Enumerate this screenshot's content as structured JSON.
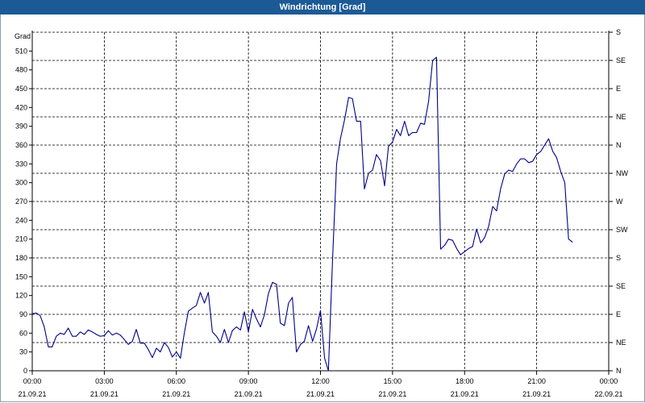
{
  "window": {
    "title": "Windrichtung [Grad]"
  },
  "chart_data": {
    "type": "line",
    "title": "Windrichtung [Grad]",
    "ylabel": "Grad",
    "ylim": [
      0,
      540
    ],
    "yticks": [
      0,
      30,
      60,
      90,
      120,
      150,
      180,
      210,
      240,
      270,
      300,
      330,
      360,
      390,
      420,
      450,
      480,
      510
    ],
    "y2ticks": [
      {
        "value": 0,
        "label": "N"
      },
      {
        "value": 45,
        "label": "NE"
      },
      {
        "value": 90,
        "label": "E"
      },
      {
        "value": 135,
        "label": "SE"
      },
      {
        "value": 180,
        "label": "S"
      },
      {
        "value": 225,
        "label": "SW"
      },
      {
        "value": 270,
        "label": "W"
      },
      {
        "value": 315,
        "label": "NW"
      },
      {
        "value": 360,
        "label": "N"
      },
      {
        "value": 405,
        "label": "NE"
      },
      {
        "value": 450,
        "label": "E"
      },
      {
        "value": 495,
        "label": "SE"
      },
      {
        "value": 540,
        "label": "S"
      }
    ],
    "xlim": [
      0,
      24
    ],
    "xticks": [
      {
        "value": 0,
        "time": "00:00",
        "date": "21.09.21"
      },
      {
        "value": 3,
        "time": "03:00",
        "date": "21.09.21"
      },
      {
        "value": 6,
        "time": "06:00",
        "date": "21.09.21"
      },
      {
        "value": 9,
        "time": "09:00",
        "date": "21.09.21"
      },
      {
        "value": 12,
        "time": "12:00",
        "date": "21.09.21"
      },
      {
        "value": 15,
        "time": "15:00",
        "date": "21.09.21"
      },
      {
        "value": 18,
        "time": "18:00",
        "date": "21.09.21"
      },
      {
        "value": 21,
        "time": "21:00",
        "date": "21.09.21"
      },
      {
        "value": 24,
        "time": "00:00",
        "date": "22.09.21"
      }
    ],
    "grid": true,
    "line_color": "#00008b",
    "x": [
      0,
      0.17,
      0.33,
      0.5,
      0.67,
      0.83,
      1,
      1.17,
      1.33,
      1.5,
      1.67,
      1.83,
      2,
      2.17,
      2.33,
      2.5,
      2.67,
      2.83,
      3,
      3.17,
      3.33,
      3.5,
      3.67,
      3.83,
      4,
      4.17,
      4.33,
      4.5,
      4.67,
      4.83,
      5,
      5.17,
      5.33,
      5.5,
      5.67,
      5.83,
      6,
      6.17,
      6.33,
      6.5,
      6.67,
      6.83,
      7,
      7.17,
      7.33,
      7.5,
      7.67,
      7.83,
      8,
      8.17,
      8.33,
      8.5,
      8.67,
      8.83,
      9,
      9.17,
      9.33,
      9.5,
      9.67,
      9.83,
      10,
      10.17,
      10.33,
      10.5,
      10.67,
      10.83,
      11,
      11.17,
      11.33,
      11.5,
      11.67,
      11.83,
      12,
      12.17,
      12.33,
      12.5,
      12.67,
      12.83,
      13,
      13.17,
      13.33,
      13.5,
      13.67,
      13.83,
      14,
      14.17,
      14.33,
      14.5,
      14.67,
      14.83,
      15,
      15.17,
      15.33,
      15.5,
      15.67,
      15.83,
      16,
      16.17,
      16.33,
      16.5,
      16.67,
      16.83,
      17,
      17.17,
      17.33,
      17.5,
      17.67,
      17.83,
      18,
      18.17,
      18.33,
      18.5,
      18.67,
      18.83,
      19,
      19.17,
      19.33,
      19.5,
      19.67,
      19.83,
      20,
      20.17,
      20.33,
      20.5,
      20.67,
      20.83,
      21,
      21.17,
      21.33,
      21.5,
      21.67,
      21.83,
      22,
      22.17,
      22.33,
      22.5,
      22.67,
      22.83,
      23,
      23.17,
      23.33,
      23.5,
      23.67,
      23.83
    ],
    "series": [
      {
        "values": [
          91,
          92,
          88,
          70,
          38,
          38,
          55,
          60,
          58,
          68,
          55,
          55,
          62,
          58,
          65,
          62,
          58,
          55,
          56,
          64,
          57,
          60,
          57,
          50,
          42,
          47,
          66,
          44,
          44,
          34,
          21,
          36,
          30,
          45,
          37,
          22,
          30,
          20,
          60,
          95,
          100,
          104,
          125,
          108,
          125,
          62,
          55,
          45,
          66,
          45,
          64,
          70,
          65,
          94,
          62,
          98,
          83,
          70,
          90,
          123,
          141,
          138,
          76,
          72,
          108,
          117,
          30,
          42,
          47,
          72,
          47,
          66,
          96,
          20,
          0,
          175,
          330,
          370,
          400,
          436,
          434,
          398,
          398,
          290,
          315,
          320,
          345,
          335,
          295,
          358,
          365,
          385,
          375,
          398,
          375,
          380,
          380,
          395,
          393,
          430,
          495,
          500,
          194,
          200,
          210,
          208,
          195,
          185,
          190,
          195,
          198,
          226,
          204,
          212,
          230,
          262,
          255,
          290,
          314,
          320,
          318,
          330,
          338,
          338,
          332,
          334,
          345,
          350,
          360,
          370,
          350,
          340,
          318,
          300,
          210,
          205
        ]
      }
    ]
  }
}
